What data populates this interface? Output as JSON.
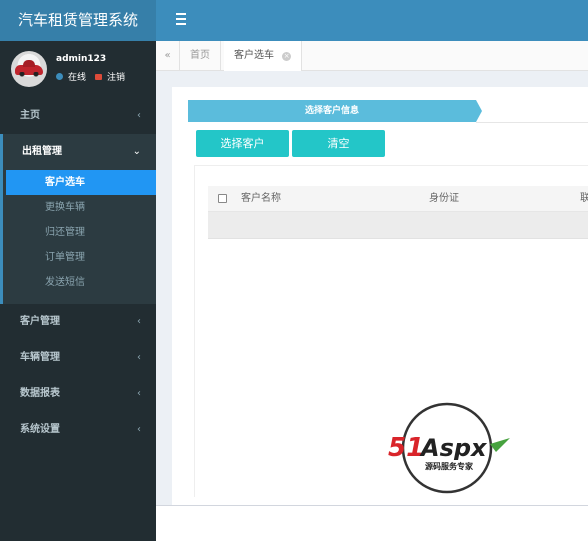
{
  "app": {
    "title": "汽车租赁管理系统"
  },
  "user": {
    "name": "admin123",
    "status": "在线",
    "logout": "注销"
  },
  "sidebar": {
    "items": [
      {
        "label": "主页"
      },
      {
        "label": "出租管理"
      },
      {
        "label": "客户管理"
      },
      {
        "label": "车辆管理"
      },
      {
        "label": "数据报表"
      },
      {
        "label": "系统设置"
      }
    ],
    "sub_items": [
      {
        "label": "客户选车"
      },
      {
        "label": "更换车辆"
      },
      {
        "label": "归还管理"
      },
      {
        "label": "订单管理"
      },
      {
        "label": "发送短信"
      }
    ],
    "active_sub": "客户选车"
  },
  "tabs": {
    "home": "首页",
    "active": "客户选车"
  },
  "content": {
    "section_title": "选择客户信息",
    "buttons": {
      "select": "选择客户",
      "clear": "清空"
    },
    "table": {
      "columns": [
        "客户名称",
        "身份证",
        "联"
      ]
    }
  },
  "watermark": {
    "brand": "51Aspx",
    "tagline": "源码服务专家"
  },
  "colors": {
    "header": "#3c8dbc",
    "logo": "#367fa9",
    "sidebar": "#222d32",
    "active": "#2196f3",
    "button": "#23c6c8",
    "banner": "#5bbcdc"
  },
  "icons": [
    "menu-icon",
    "tabs-back-icon",
    "tab-close-icon",
    "chevron-left-icon",
    "chevron-down-icon",
    "online-dot-icon",
    "logout-icon"
  ]
}
